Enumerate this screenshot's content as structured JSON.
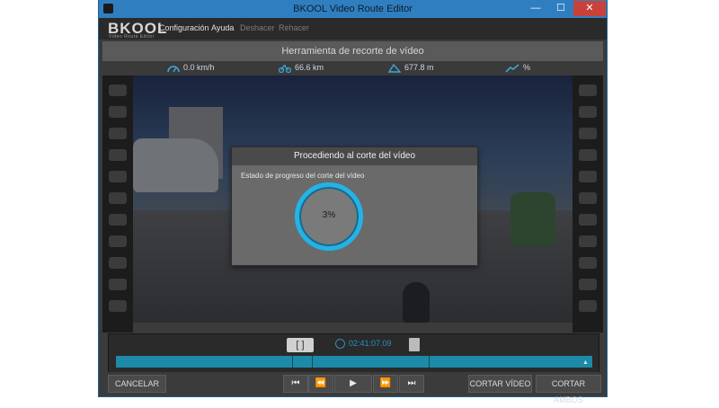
{
  "window": {
    "title": "BKOOL Video Route Editor",
    "min": "—",
    "max": "☐",
    "close": "✕"
  },
  "menubar": {
    "logo": "BKOOL",
    "logo_sub": "Video Route Editor",
    "items": [
      "Configuración",
      "Ayuda",
      "Deshacer",
      "Rehacer"
    ]
  },
  "tool_title": "Herramienta de recorte de vídeo",
  "stats": {
    "speed": "0.0 km/h",
    "distance": "66.6 km",
    "altitude": "677.8 m",
    "slope": "%"
  },
  "dialog": {
    "title": "Procediendo al corte del vídeo",
    "label": "Estado de progreso del corte del vídeo",
    "progress": "3%",
    "progress_value": 3
  },
  "timeline": {
    "bracket": "[ ]",
    "time": "02:41:07.09",
    "cursor": "▲"
  },
  "controls": {
    "cancel": "CANCELAR",
    "cut_video": "CORTAR VÍDEO",
    "cut_both": "CORTAR AMBOS",
    "first": "⏮",
    "rewind": "⏪",
    "play": "▶",
    "forward": "⏩",
    "last": "⏭"
  },
  "colors": {
    "accent": "#23b3e6",
    "timeline": "#1c8aa8",
    "titlebar": "#2f7fc0"
  }
}
